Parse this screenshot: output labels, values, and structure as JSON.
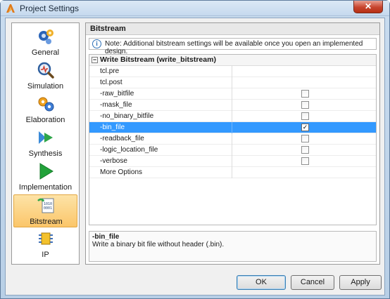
{
  "window": {
    "title": "Project Settings",
    "close_label": "✕"
  },
  "nav": {
    "items": [
      {
        "label": "General",
        "icon": "general-icon"
      },
      {
        "label": "Simulation",
        "icon": "simulation-icon"
      },
      {
        "label": "Elaboration",
        "icon": "elaboration-icon"
      },
      {
        "label": "Synthesis",
        "icon": "synthesis-icon"
      },
      {
        "label": "Implementation",
        "icon": "implementation-icon"
      },
      {
        "label": "Bitstream",
        "icon": "bitstream-icon"
      },
      {
        "label": "IP",
        "icon": "ip-icon"
      }
    ],
    "selected": "Bitstream"
  },
  "panel": {
    "header": "Bitstream",
    "note": "Note: Additional bitstream settings will be available once you open an implemented design.",
    "section_title": "Write Bitstream (write_bitstream)",
    "rows": [
      {
        "name": "tcl.pre",
        "checkbox": false,
        "checked": false
      },
      {
        "name": "tcl.post",
        "checkbox": false,
        "checked": false
      },
      {
        "name": "-raw_bitfile",
        "checkbox": true,
        "checked": false
      },
      {
        "name": "-mask_file",
        "checkbox": true,
        "checked": false
      },
      {
        "name": "-no_binary_bitfile",
        "checkbox": true,
        "checked": false
      },
      {
        "name": "-bin_file",
        "checkbox": true,
        "checked": true,
        "selected": true
      },
      {
        "name": "-readback_file",
        "checkbox": true,
        "checked": false
      },
      {
        "name": "-logic_location_file",
        "checkbox": true,
        "checked": false
      },
      {
        "name": "-verbose",
        "checkbox": true,
        "checked": false
      },
      {
        "name": "More Options",
        "checkbox": false,
        "checked": false
      }
    ],
    "description": {
      "name": "-bin_file",
      "text": "Write a binary bit file without header (.bin)."
    }
  },
  "buttons": {
    "ok": "OK",
    "cancel": "Cancel",
    "apply": "Apply"
  },
  "colors": {
    "selection": "#3399ff",
    "nav_selected": "#fbc66a"
  }
}
